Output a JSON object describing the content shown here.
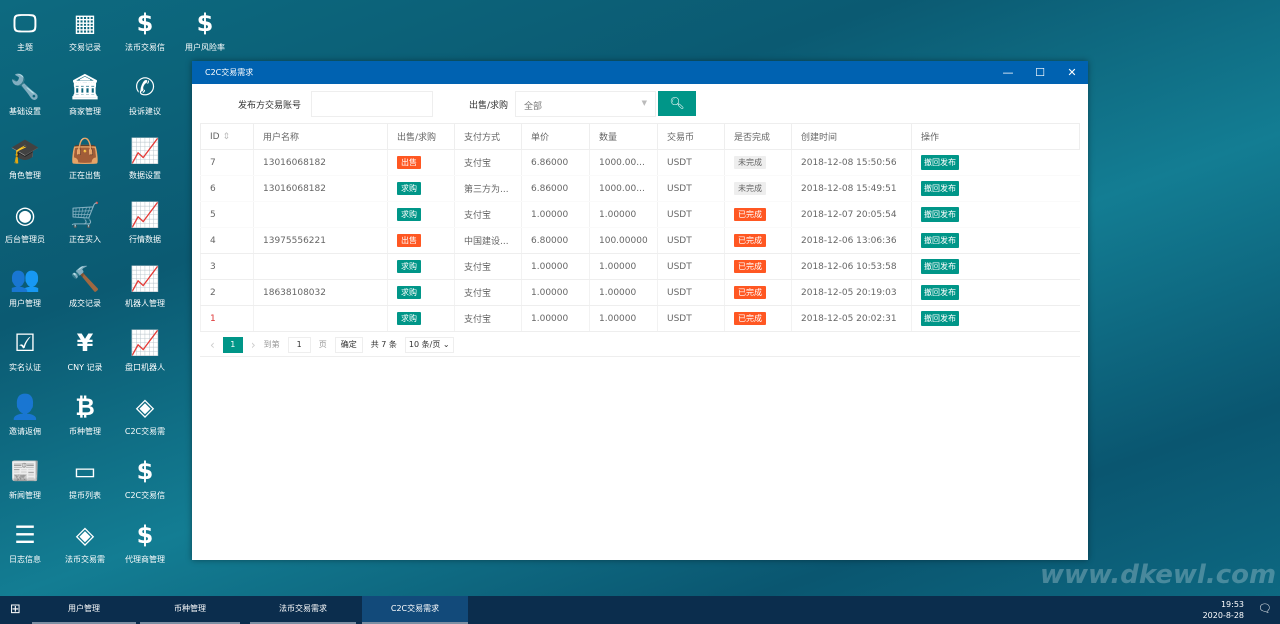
{
  "desktop": {
    "icons": [
      {
        "label": "主题",
        "icon": "monitor-icon",
        "glyph": "🖵"
      },
      {
        "label": "交易记录",
        "icon": "building-icon",
        "glyph": "▦"
      },
      {
        "label": "法币交易信",
        "icon": "dollar-icon",
        "glyph": "$"
      },
      {
        "label": "用户风险率",
        "icon": "dollar-icon",
        "glyph": "$"
      },
      {
        "label": "基础设置",
        "icon": "wrench-icon",
        "glyph": "🔧"
      },
      {
        "label": "商家管理",
        "icon": "bank-icon",
        "glyph": "🏛"
      },
      {
        "label": "投诉建议",
        "icon": "phone-icon",
        "glyph": "✆"
      },
      {
        "label": "角色管理",
        "icon": "graduation-cap-icon",
        "glyph": "🎓"
      },
      {
        "label": "正在出售",
        "icon": "shopping-bag-icon",
        "glyph": "👜"
      },
      {
        "label": "数据设置",
        "icon": "line-chart-icon",
        "glyph": "📈"
      },
      {
        "label": "后台管理员",
        "icon": "user-circle-icon",
        "glyph": "◉"
      },
      {
        "label": "正在买入",
        "icon": "cart-icon",
        "glyph": "🛒"
      },
      {
        "label": "行情数据",
        "icon": "line-chart-icon",
        "glyph": "📈"
      },
      {
        "label": "用户管理",
        "icon": "users-icon",
        "glyph": "👥"
      },
      {
        "label": "成交记录",
        "icon": "gavel-icon",
        "glyph": "🔨"
      },
      {
        "label": "机器人管理",
        "icon": "line-chart-icon",
        "glyph": "📈"
      },
      {
        "label": "实名认证",
        "icon": "check-square-icon",
        "glyph": "☑"
      },
      {
        "label": "CNY 记录",
        "icon": "yen-icon",
        "glyph": "¥"
      },
      {
        "label": "盘口机器人",
        "icon": "line-chart-icon",
        "glyph": "📈"
      },
      {
        "label": "邀请返佣",
        "icon": "user-plus-icon",
        "glyph": "👤"
      },
      {
        "label": "币种管理",
        "icon": "bitcoin-icon",
        "glyph": "₿"
      },
      {
        "label": "C2C交易需",
        "icon": "exchange-icon",
        "glyph": "◈"
      },
      {
        "label": "新闻管理",
        "icon": "newspaper-icon",
        "glyph": "📰"
      },
      {
        "label": "提币列表",
        "icon": "credit-card-icon",
        "glyph": "▭"
      },
      {
        "label": "C2C交易信",
        "icon": "dollar-icon",
        "glyph": "$"
      },
      {
        "label": "日志信息",
        "icon": "list-icon",
        "glyph": "☰"
      },
      {
        "label": "法币交易需",
        "icon": "exchange-icon",
        "glyph": "◈"
      },
      {
        "label": "代理商管理",
        "icon": "dollar-icon",
        "glyph": "$"
      }
    ]
  },
  "window": {
    "title": "C2C交易需求",
    "minimize": "—",
    "maximize": "☐",
    "close": "✕"
  },
  "filter": {
    "account_label": "发布方交易账号",
    "account_value": "",
    "type_label": "出售/求购",
    "type_value": "全部",
    "search_icon": "search-icon"
  },
  "table": {
    "headers": [
      "ID",
      "用户名称",
      "出售/求购",
      "支付方式",
      "单价",
      "数量",
      "交易币",
      "是否完成",
      "创建时间",
      "操作"
    ],
    "rows": [
      {
        "id": "7",
        "user": "13016068182",
        "type": "出售",
        "pay": "支付宝",
        "price": "6.86000",
        "qty": "1000.00...",
        "coin": "USDT",
        "status": "未完成",
        "time": "2018-12-08 15:50:56",
        "action": "撤回发布"
      },
      {
        "id": "6",
        "user": "13016068182",
        "type": "求购",
        "pay": "第三方为...",
        "price": "6.86000",
        "qty": "1000.00...",
        "coin": "USDT",
        "status": "未完成",
        "time": "2018-12-08 15:49:51",
        "action": "撤回发布"
      },
      {
        "id": "5",
        "user": "",
        "type": "求购",
        "pay": "支付宝",
        "price": "1.00000",
        "qty": "1.00000",
        "coin": "USDT",
        "status": "已完成",
        "time": "2018-12-07 20:05:54",
        "action": "撤回发布"
      },
      {
        "id": "4",
        "user": "13975556221",
        "type": "出售",
        "pay": "中国建设...",
        "price": "6.80000",
        "qty": "100.00000",
        "coin": "USDT",
        "status": "已完成",
        "time": "2018-12-06 13:06:36",
        "action": "撤回发布"
      },
      {
        "id": "3",
        "user": "",
        "type": "求购",
        "pay": "支付宝",
        "price": "1.00000",
        "qty": "1.00000",
        "coin": "USDT",
        "status": "已完成",
        "time": "2018-12-06 10:53:58",
        "action": "撤回发布"
      },
      {
        "id": "2",
        "user": "18638108032",
        "type": "求购",
        "pay": "支付宝",
        "price": "1.00000",
        "qty": "1.00000",
        "coin": "USDT",
        "status": "已完成",
        "time": "2018-12-05 20:19:03",
        "action": "撤回发布"
      },
      {
        "id": "1",
        "user": "",
        "type": "求购",
        "pay": "支付宝",
        "price": "1.00000",
        "qty": "1.00000",
        "coin": "USDT",
        "status": "已完成",
        "time": "2018-12-05 20:02:31",
        "action": "撤回发布"
      }
    ]
  },
  "pager": {
    "prev": "‹",
    "current": "1",
    "next": "›",
    "goto_label": "到第",
    "goto_value": "1",
    "page_unit": "页",
    "confirm": "确定",
    "total": "共 7 条",
    "page_size": "10 条/页"
  },
  "taskbar": {
    "start_icon": "windows-icon",
    "items": [
      "用户管理",
      "币种管理",
      "法币交易需求",
      "C2C交易需求"
    ],
    "active": "C2C交易需求",
    "time": "19:53",
    "date": "2020-8-28",
    "notification_icon": "chat-bubble-icon"
  },
  "watermark": "www.dkewl.com",
  "colors": {
    "titlebar": "#0062b1",
    "primary": "#009688",
    "sell": "#ff5722",
    "done": "#ff5722",
    "pending_bg": "#eeeeee",
    "taskbar": "#0b2d4d"
  }
}
